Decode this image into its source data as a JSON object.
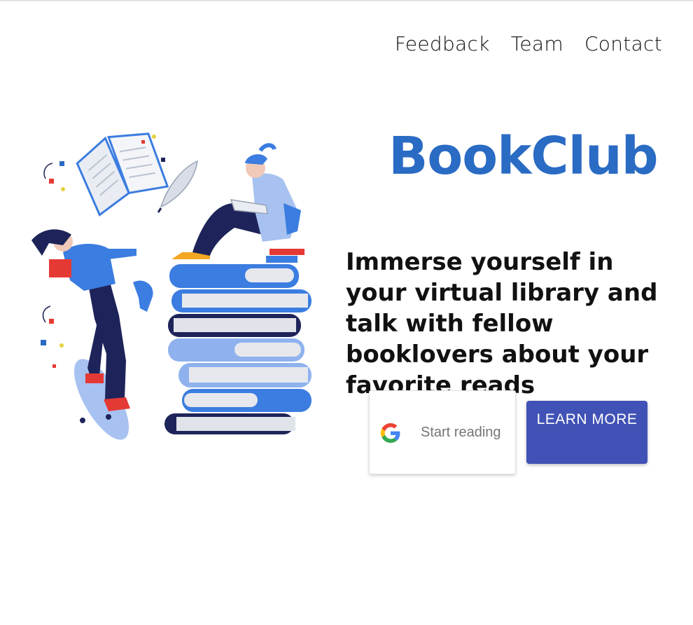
{
  "nav": {
    "items": [
      {
        "label": "Feedback"
      },
      {
        "label": "Team"
      },
      {
        "label": "Contact"
      }
    ]
  },
  "hero": {
    "brand": "BookClub",
    "tagline": "Immerse yourself in your virtual library and talk with fellow booklovers about your favorite reads"
  },
  "actions": {
    "google_button_label": "Start reading",
    "google_icon": "google-g-icon",
    "learn_more_label": "LEARN MORE"
  },
  "colors": {
    "brand": "#2a6bc4",
    "learn_more_bg": "#4052b5",
    "illustration_blue": "#3b7de0",
    "illustration_navy": "#1e2459"
  }
}
